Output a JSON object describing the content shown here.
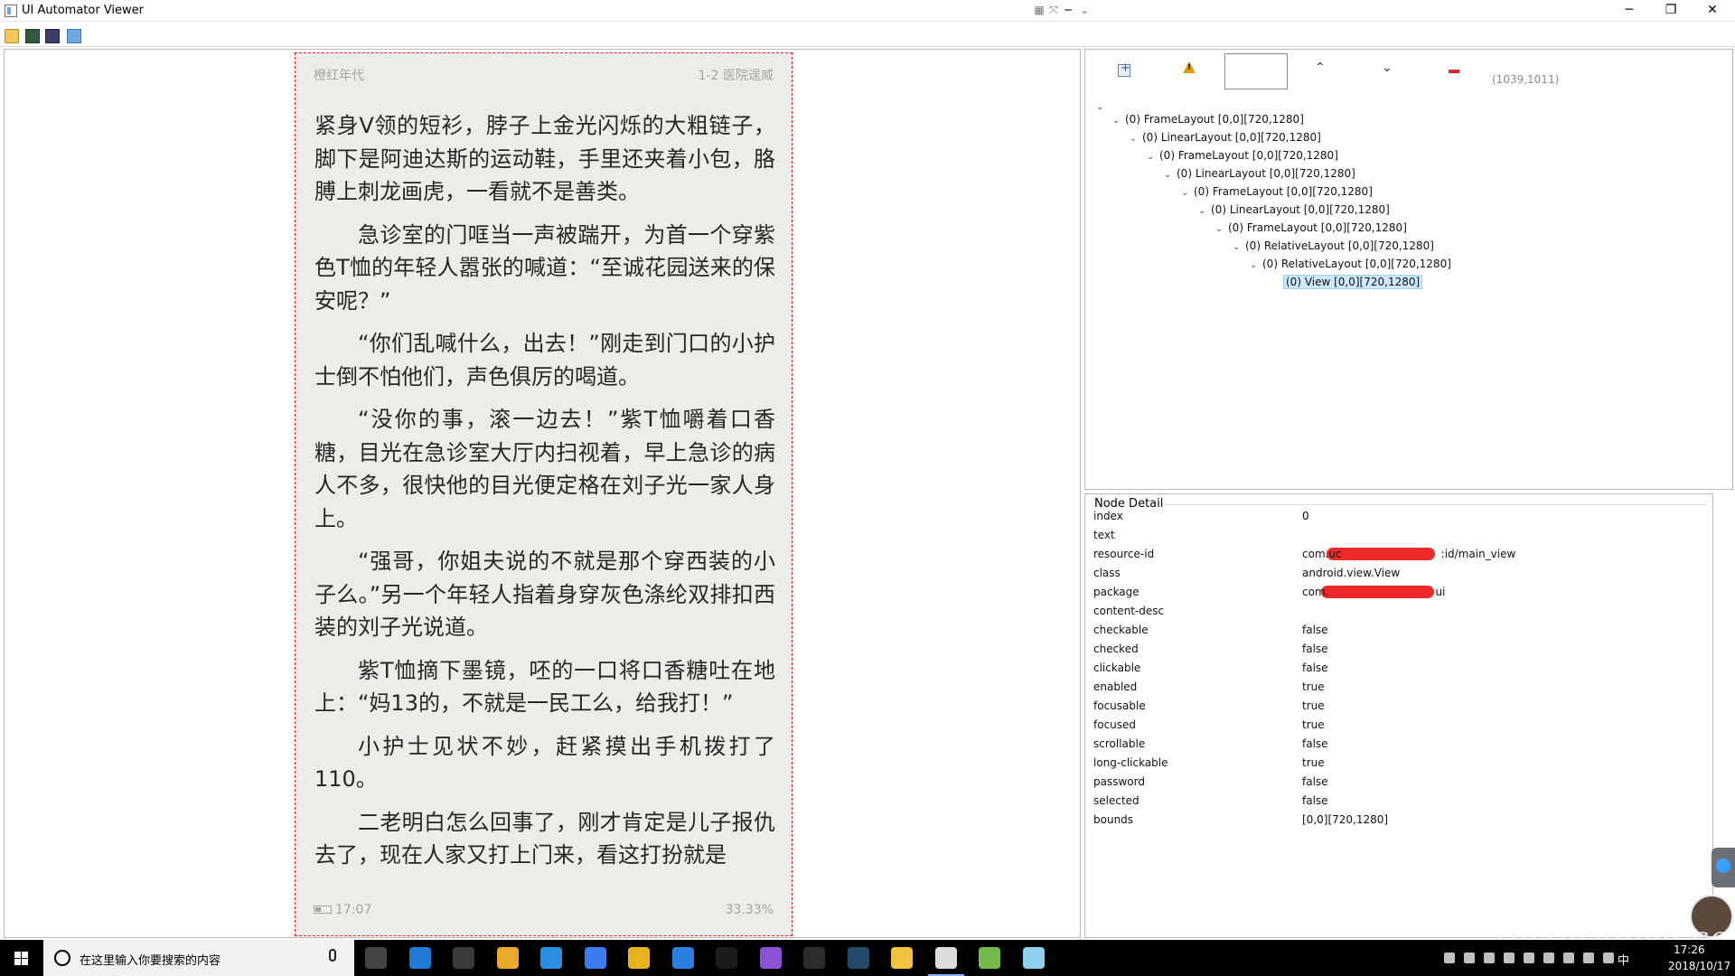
{
  "window": {
    "title": "UI Automator Viewer",
    "minimize": "─",
    "maximize": "❐",
    "close": "✕"
  },
  "toolbar": {
    "icons": [
      "open-folder-icon",
      "device-screenshot-icon",
      "device-screenshot-compressed-icon",
      "save-icon"
    ]
  },
  "device": {
    "book_title": "橙红年代",
    "chapter": "1-2 医院逞威",
    "paragraphs": [
      {
        "indent": false,
        "text": "紧身V领的短衫，脖子上金光闪烁的大粗链子，脚下是阿迪达斯的运动鞋，手里还夹着小包，胳膊上刺龙画虎，一看就不是善类。"
      },
      {
        "indent": true,
        "text": "急诊室的门哐当一声被踹开，为首一个穿紫色T恤的年轻人嚣张的喊道：“至诚花园送来的保安呢？”"
      },
      {
        "indent": true,
        "text": "“你们乱喊什么，出去！”刚走到门口的小护士倒不怕他们，声色俱厉的喝道。"
      },
      {
        "indent": true,
        "text": "“没你的事，滚一边去！”紫T恤嚼着口香糖，目光在急诊室大厅内扫视着，早上急诊的病人不多，很快他的目光便定格在刘子光一家人身上。"
      },
      {
        "indent": true,
        "text": "“强哥，你姐夫说的不就是那个穿西装的小子么。”另一个年轻人指着身穿灰色涤纶双排扣西装的刘子光说道。"
      },
      {
        "indent": true,
        "text": "紫T恤摘下墨镜，呸的一口将口香糖吐在地上：“妈13的，不就是一民工么，给我打！”"
      },
      {
        "indent": true,
        "text": "小护士见状不妙，赶紧摸出手机拨打了110。"
      },
      {
        "indent": true,
        "text": "二老明白怎么回事了，刚才肯定是儿子报仇去了，现在人家又打上门来，看这打扮就是"
      }
    ],
    "time": "17:07",
    "progress": "33.33%"
  },
  "tree_toolbar": {
    "coords": "(1039,1011)",
    "prev": "⌃",
    "next": "⌄"
  },
  "tree": {
    "root_caret": "⌄",
    "nodes": [
      {
        "depth": 0,
        "label": "(0) FrameLayout [0,0][720,1280]"
      },
      {
        "depth": 1,
        "label": "(0) LinearLayout [0,0][720,1280]"
      },
      {
        "depth": 2,
        "label": "(0) FrameLayout [0,0][720,1280]"
      },
      {
        "depth": 3,
        "label": "(0) LinearLayout [0,0][720,1280]"
      },
      {
        "depth": 4,
        "label": "(0) FrameLayout [0,0][720,1280]"
      },
      {
        "depth": 5,
        "label": "(0) LinearLayout [0,0][720,1280]"
      },
      {
        "depth": 6,
        "label": "(0) FrameLayout [0,0][720,1280]"
      },
      {
        "depth": 7,
        "label": "(0) RelativeLayout [0,0][720,1280]"
      },
      {
        "depth": 8,
        "label": "(0) RelativeLayout [0,0][720,1280]"
      },
      {
        "depth": 9,
        "label": "(0) View [0,0][720,1280]",
        "selected": true
      }
    ]
  },
  "node_detail": {
    "title": "Node Detail",
    "rows": [
      {
        "key": "index",
        "value": "0"
      },
      {
        "key": "text",
        "value": ""
      },
      {
        "key": "resource-id",
        "value": "com.uc",
        "value_tail": ":id/main_view"
      },
      {
        "key": "class",
        "value": "android.view.View"
      },
      {
        "key": "package",
        "value": "com.",
        "value_tail": "ui"
      },
      {
        "key": "content-desc",
        "value": ""
      },
      {
        "key": "checkable",
        "value": "false"
      },
      {
        "key": "checked",
        "value": "false"
      },
      {
        "key": "clickable",
        "value": "false"
      },
      {
        "key": "enabled",
        "value": "true"
      },
      {
        "key": "focusable",
        "value": "true"
      },
      {
        "key": "focused",
        "value": "true"
      },
      {
        "key": "scrollable",
        "value": "false"
      },
      {
        "key": "long-clickable",
        "value": "true"
      },
      {
        "key": "password",
        "value": "false"
      },
      {
        "key": "selected",
        "value": "false"
      },
      {
        "key": "bounds",
        "value": "[0,0][720,1280]"
      }
    ]
  },
  "watermark": "testerhome.com",
  "taskbar": {
    "search_placeholder": "在这里输入你要搜索的内容",
    "ime": "中",
    "time": "17:26",
    "date": "2018/10/17",
    "apps": [
      {
        "name": "task-view-icon",
        "color": "#444444"
      },
      {
        "name": "edge-icon",
        "color": "#1f7ad6"
      },
      {
        "name": "store-icon",
        "color": "#3a3a3a"
      },
      {
        "name": "chrome-icon",
        "color": "#e9a92a"
      },
      {
        "name": "ie-icon",
        "color": "#2b8fe0"
      },
      {
        "name": "baidu-netdisk-icon",
        "color": "#3b7bf0"
      },
      {
        "name": "app-green-icon",
        "color": "#e8b320"
      },
      {
        "name": "teamviewer-icon",
        "color": "#2a7fe0"
      },
      {
        "name": "pycharm-icon",
        "color": "#1b1b1b"
      },
      {
        "name": "app-purple-icon",
        "color": "#8a52d6"
      },
      {
        "name": "terminal-icon",
        "color": "#2c2c2c"
      },
      {
        "name": "nox-icon",
        "color": "#234a6a"
      },
      {
        "name": "file-explorer-icon",
        "color": "#f1c23e"
      },
      {
        "name": "uiautomatorviewer-icon",
        "color": "#dcdcdc"
      },
      {
        "name": "notepad-icon",
        "color": "#74b94a"
      },
      {
        "name": "app-blue-icon",
        "color": "#8fd0ee"
      }
    ]
  }
}
